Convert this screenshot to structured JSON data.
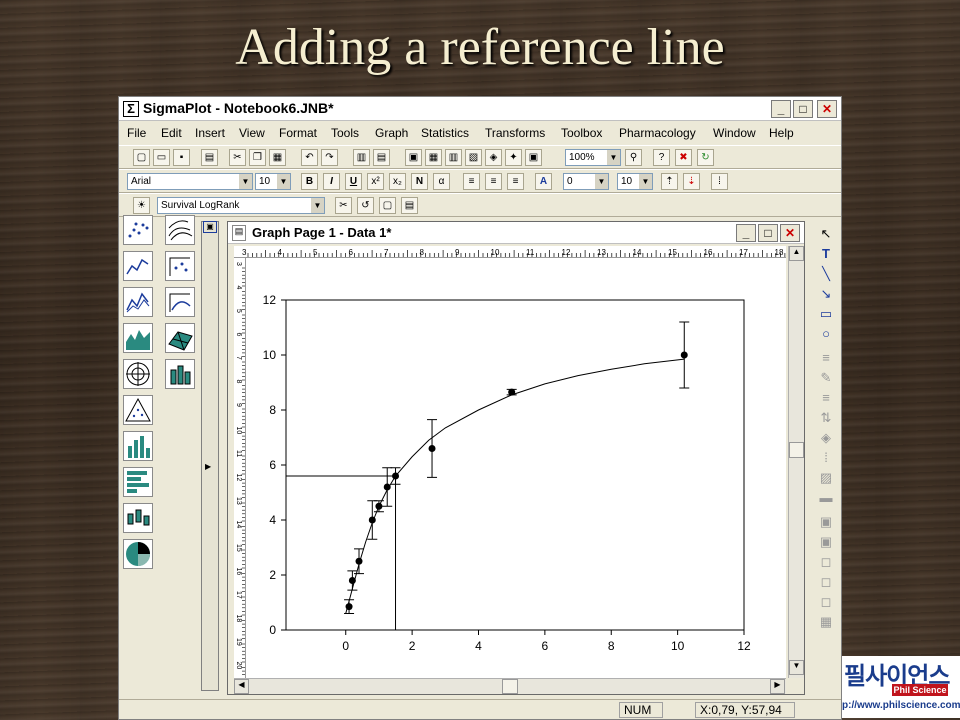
{
  "slide": {
    "title": "Adding a reference line"
  },
  "app": {
    "title": "SigmaPlot - Notebook6.JNB*",
    "minimize": "_",
    "maximize": "□",
    "close": "✕"
  },
  "menu": [
    "File",
    "Edit",
    "Insert",
    "View",
    "Format",
    "Tools",
    "Graph",
    "Statistics",
    "Transforms",
    "Toolbox",
    "Pharmacology",
    "Window",
    "Help"
  ],
  "toolbar1": {
    "zoom": "100%"
  },
  "toolbar2": {
    "font": "Arial",
    "size": "10",
    "bold": "B",
    "italic": "I",
    "underline": "U",
    "normal": "N",
    "alpha": "α",
    "line_value": "0",
    "line_size": "10"
  },
  "toolbar3": {
    "transform": "Survival LogRank"
  },
  "graph_window": {
    "title": "Graph Page 1 - Data 1*",
    "ruler_numbers": [
      "3",
      "4",
      "5",
      "6",
      "7",
      "8",
      "9",
      "10",
      "11",
      "12",
      "13",
      "14",
      "15",
      "16",
      "17",
      "18"
    ],
    "vruler_numbers": [
      "3",
      "4",
      "5",
      "6",
      "7",
      "8",
      "9",
      "10",
      "11",
      "12",
      "13",
      "14",
      "15",
      "16",
      "17",
      "18",
      "19",
      "20"
    ]
  },
  "chart_data": {
    "type": "scatter",
    "x_ticks": [
      0,
      2,
      4,
      6,
      8,
      10,
      12
    ],
    "y_ticks": [
      0,
      2,
      4,
      6,
      8,
      10,
      12
    ],
    "xlim": [
      -1.8,
      12
    ],
    "ylim": [
      0,
      12
    ],
    "points": [
      {
        "x": 0.1,
        "y": 0.85,
        "err": 0.25
      },
      {
        "x": 0.2,
        "y": 1.8,
        "err": 0.35
      },
      {
        "x": 0.4,
        "y": 2.5,
        "err": 0.45
      },
      {
        "x": 0.8,
        "y": 4.0,
        "err": 0.7
      },
      {
        "x": 1.0,
        "y": 4.5,
        "err": 0.2
      },
      {
        "x": 1.25,
        "y": 5.2,
        "err": 0.7
      },
      {
        "x": 1.5,
        "y": 5.6,
        "err": 0.3
      },
      {
        "x": 2.6,
        "y": 6.6,
        "err": 1.05
      },
      {
        "x": 5.0,
        "y": 8.65,
        "err": 0.1
      },
      {
        "x": 10.2,
        "y": 10.0,
        "err": 1.2
      }
    ],
    "fit_curve": [
      [
        0,
        0.6
      ],
      [
        0.2,
        1.5
      ],
      [
        0.4,
        2.4
      ],
      [
        0.6,
        3.2
      ],
      [
        0.8,
        3.9
      ],
      [
        1.0,
        4.5
      ],
      [
        1.25,
        5.1
      ],
      [
        1.5,
        5.6
      ],
      [
        2,
        6.3
      ],
      [
        2.5,
        6.9
      ],
      [
        3,
        7.35
      ],
      [
        4,
        8.0
      ],
      [
        5,
        8.55
      ],
      [
        6,
        8.95
      ],
      [
        7,
        9.25
      ],
      [
        8,
        9.48
      ],
      [
        9,
        9.68
      ],
      [
        10.2,
        9.85
      ]
    ],
    "reference_line": {
      "x": 1.5,
      "y": 5.6
    },
    "grid": false
  },
  "tools": [
    "↖",
    "T",
    "╲",
    "↘",
    "▭",
    "○",
    "≡",
    "✎",
    "≡",
    "⇅",
    "◈",
    "⁞",
    "▨",
    "▬",
    "▣",
    "▣",
    "◻",
    "◻",
    "◻",
    "▦"
  ],
  "status": {
    "num": "NUM",
    "coords": "X:0,79, Y:57,94"
  },
  "logo": {
    "korean": "필사이언스",
    "badge": "Phil Science",
    "url": "p://www.philscience.com"
  },
  "colors": {
    "fit_line": "#000000",
    "window_bg": "#ece9d8",
    "palette_fill": "#2a8a80"
  }
}
